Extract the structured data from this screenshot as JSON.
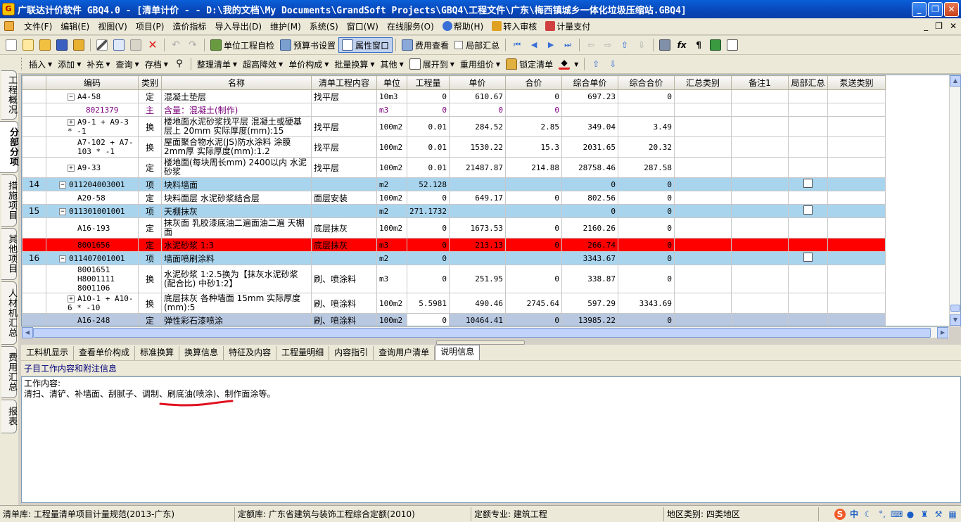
{
  "window": {
    "title": "广联达计价软件 GBQ4.0 - [清单计价 - - D:\\我的文档\\My Documents\\GrandSoft Projects\\GBQ4\\工程文件\\广东\\梅西镇城乡一体化垃圾压缩站.GBQ4]"
  },
  "menu": [
    {
      "label": "文件(F)"
    },
    {
      "label": "编辑(E)"
    },
    {
      "label": "视图(V)"
    },
    {
      "label": "项目(P)"
    },
    {
      "label": "造价指标"
    },
    {
      "label": "导入导出(D)"
    },
    {
      "label": "维护(M)"
    },
    {
      "label": "系统(S)"
    },
    {
      "label": "窗口(W)"
    },
    {
      "label": "在线服务(O)"
    },
    {
      "label": "帮助(H)"
    },
    {
      "label": "转入审核"
    },
    {
      "label": "计量支付"
    }
  ],
  "toolbar1": {
    "self_check": "单位工程自检",
    "report_settings": "预算书设置",
    "property_window": "属性窗口",
    "fee_view": "费用查看",
    "partial_summary": "局部汇总"
  },
  "toolbar2": {
    "insert": "插入",
    "add": "添加",
    "supplement": "补充",
    "query": "查询",
    "save": "存档",
    "organize": "整理清单",
    "super_reduce": "超高降效",
    "unit_price_comp": "单价构成",
    "batch_convert": "批量换算",
    "other": "其他",
    "expand_to": "展开到",
    "reuse_group": "重用组价",
    "lock_list": "锁定清单"
  },
  "left_tabs": [
    {
      "label": "工程概况"
    },
    {
      "label": "分部分项"
    },
    {
      "label": "措施项目"
    },
    {
      "label": "其他项目"
    },
    {
      "label": "人材机汇总"
    },
    {
      "label": "费用汇总"
    },
    {
      "label": "报表"
    }
  ],
  "grid": {
    "columns": [
      "编码",
      "类别",
      "名称",
      "清单工程内容",
      "单位",
      "工程量",
      "单价",
      "合价",
      "综合单价",
      "综合合价",
      "汇总类别",
      "备注1",
      "局部汇总",
      "泵送类别"
    ],
    "rows": [
      {
        "no": "",
        "code": "A4-58",
        "type": "定",
        "name": "混凝土垫层",
        "content": "找平层",
        "unit": "10m3",
        "qty": "0",
        "price": "610.67",
        "total": "0",
        "comp_price": "697.23",
        "comp_total": "0",
        "style": "normal",
        "exp": "−",
        "indent": 1
      },
      {
        "no": "",
        "code": "8021379",
        "type": "主",
        "name": "含量：混凝土(制作)",
        "content": "",
        "unit": "m3",
        "qty": "0",
        "price": "0",
        "total": "0",
        "comp_price": "",
        "comp_total": "",
        "style": "main",
        "exp": "",
        "indent": 2
      },
      {
        "no": "",
        "code": "A9-1 + A9-3 * -1",
        "type": "换",
        "name": "楼地面水泥砂浆找平层 混凝土或硬基层上 20mm 实际厚度(mm):15",
        "content": "找平层",
        "unit": "100m2",
        "qty": "0.01",
        "price": "284.52",
        "total": "2.85",
        "comp_price": "349.04",
        "comp_total": "3.49",
        "style": "normal",
        "exp": "+",
        "indent": 1
      },
      {
        "no": "",
        "code": "A7-102 + A7-103 * -1",
        "type": "换",
        "name": "屋面聚合物水泥(JS)防水涂料 涂膜2mm厚 实际厚度(mm):1.2",
        "content": "找平层",
        "unit": "100m2",
        "qty": "0.01",
        "price": "1530.22",
        "total": "15.3",
        "comp_price": "2031.65",
        "comp_total": "20.32",
        "style": "normal",
        "exp": "",
        "indent": 1
      },
      {
        "no": "",
        "code": "A9-33",
        "type": "定",
        "name": "楼地面(每块周长mm) 2400以内 水泥砂浆",
        "content": "找平层",
        "unit": "100m2",
        "qty": "0.01",
        "price": "21487.87",
        "total": "214.88",
        "comp_price": "28758.46",
        "comp_total": "287.58",
        "style": "normal",
        "exp": "+",
        "indent": 1
      },
      {
        "no": "14",
        "code": "011204003001",
        "type": "项",
        "name": "块料墙面",
        "content": "",
        "unit": "m2",
        "qty": "52.128",
        "price": "",
        "total": "",
        "comp_price": "0",
        "comp_total": "0",
        "style": "qd",
        "exp": "−",
        "indent": 0,
        "check": true
      },
      {
        "no": "",
        "code": "A20-58",
        "type": "定",
        "name": "块料面层 水泥砂浆结合层",
        "content": "面层安装",
        "unit": "100m2",
        "qty": "0",
        "price": "649.17",
        "total": "0",
        "comp_price": "802.56",
        "comp_total": "0",
        "style": "normal",
        "exp": "",
        "indent": 1
      },
      {
        "no": "15",
        "code": "011301001001",
        "type": "项",
        "name": "天棚抹灰",
        "content": "",
        "unit": "m2",
        "qty": "271.1732",
        "price": "",
        "total": "",
        "comp_price": "0",
        "comp_total": "0",
        "style": "qd",
        "exp": "−",
        "indent": 0,
        "check": true
      },
      {
        "no": "",
        "code": "A16-193",
        "type": "定",
        "name": "抹灰面 乳胶漆底油二遍面油二遍 天棚面",
        "content": "底层抹灰",
        "unit": "100m2",
        "qty": "0",
        "price": "1673.53",
        "total": "0",
        "comp_price": "2160.26",
        "comp_total": "0",
        "style": "normal",
        "exp": "",
        "indent": 1
      },
      {
        "no": "",
        "code": "8001656",
        "type": "定",
        "name": "水泥砂浆 1:3",
        "content": "底层抹灰",
        "unit": "m3",
        "qty": "0",
        "price": "213.13",
        "total": "0",
        "comp_price": "266.74",
        "comp_total": "0",
        "style": "red",
        "exp": "",
        "indent": 1
      },
      {
        "no": "16",
        "code": "011407001001",
        "type": "项",
        "name": "墙面喷刷涂料",
        "content": "",
        "unit": "m2",
        "qty": "0",
        "price": "",
        "total": "",
        "comp_price": "3343.67",
        "comp_total": "0",
        "style": "qd",
        "exp": "−",
        "indent": 0,
        "check": true
      },
      {
        "no": "",
        "code": "8001651 H8001111 8001106",
        "type": "换",
        "name": "水泥砂浆 1:2.5换为【抹灰水泥砂浆(配合比) 中砂1:2】",
        "content": "刷、喷涂料",
        "unit": "m3",
        "qty": "0",
        "price": "251.95",
        "total": "0",
        "comp_price": "338.87",
        "comp_total": "0",
        "style": "normal",
        "exp": "",
        "indent": 1
      },
      {
        "no": "",
        "code": "A10-1 + A10-6 * -10",
        "type": "换",
        "name": "底层抹灰 各种墙面 15mm 实际厚度(mm):5",
        "content": "刷、喷涂料",
        "unit": "100m2",
        "qty": "5.5981",
        "price": "490.46",
        "total": "2745.64",
        "comp_price": "597.29",
        "comp_total": "3343.69",
        "style": "normal",
        "exp": "+",
        "indent": 1
      },
      {
        "no": "",
        "code": "A16-248",
        "type": "定",
        "name": "弹性彩石漆喷涂",
        "content": "刷、喷涂料",
        "unit": "100m2",
        "qty": "0",
        "price": "10464.41",
        "total": "0",
        "comp_price": "13985.22",
        "comp_total": "0",
        "style": "sel",
        "exp": "",
        "indent": 1
      }
    ]
  },
  "bottom_tabs": [
    {
      "label": "工料机显示"
    },
    {
      "label": "查看单价构成"
    },
    {
      "label": "标准换算"
    },
    {
      "label": "换算信息"
    },
    {
      "label": "特征及内容"
    },
    {
      "label": "工程量明细"
    },
    {
      "label": "内容指引"
    },
    {
      "label": "查询用户清单"
    },
    {
      "label": "说明信息",
      "active": true
    }
  ],
  "info": {
    "header": "子目工作内容和附注信息",
    "line1": "工作内容:",
    "line2": "清扫、清铲、补墙面、刮腻子、调制、刷底油(喷涂)、制作面涂等。"
  },
  "status": {
    "list_lib": "清单库: 工程量清单项目计量规范(2013-广东)",
    "quota_lib": "定额库: 广东省建筑与装饰工程综合定额(2010)",
    "quota_major": "定额专业: 建筑工程",
    "region": "地区类别: 四类地区",
    "ime": "中"
  },
  "colors": {
    "qd_row": "#a9d4ee",
    "red_row": "#ff0000",
    "selected_row": "#b8c8e0",
    "main_material_text": "#7a007a",
    "title_bar": "#0846b8"
  }
}
